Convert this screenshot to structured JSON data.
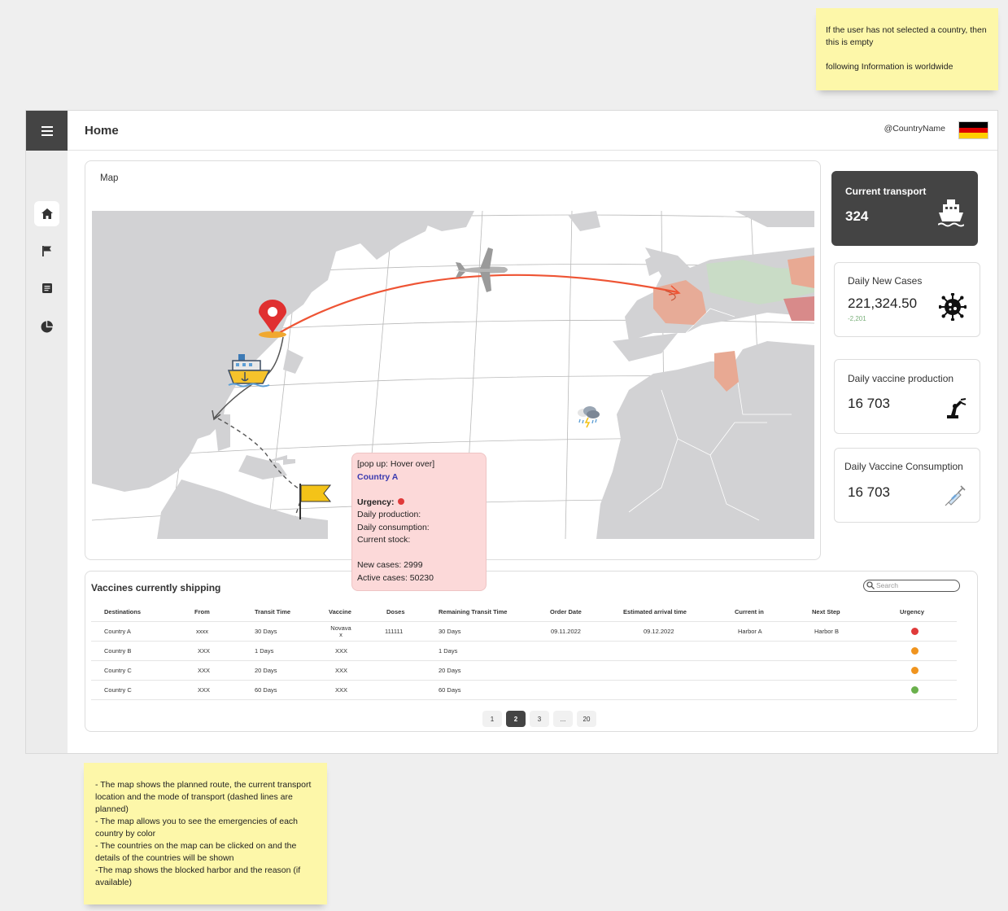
{
  "notes": {
    "top": [
      "If the user has not selected a country, then this is empty",
      "following Information is worldwide"
    ],
    "bottom": [
      "- The map shows the planned route, the current transport location and the mode of transport (dashed lines are planned)",
      "- The map allows you to see the emergencies of each country by color",
      "- The countries on the map can be clicked on and the details of the countries will be shown",
      "-The map shows the blocked harbor and the reason (if available)"
    ]
  },
  "header": {
    "title": "Home",
    "country": "@CountryName",
    "flag_colors": [
      "#000000",
      "#dd0000",
      "#ffce00"
    ]
  },
  "sidebar": {
    "items": [
      "home",
      "flag",
      "list",
      "pie-chart"
    ],
    "active": "home"
  },
  "map": {
    "title": "Map"
  },
  "popup": {
    "header": "[pop up: Hover over]",
    "country": "Country A",
    "urgency_label": "Urgency:",
    "urgency_color": "#e03a3a",
    "lines": [
      "Daily production:",
      "Daily consumption:",
      "Current stock:"
    ],
    "new_cases": "New cases: 2999",
    "active_cases": "Active cases:  50230"
  },
  "stats": {
    "transport": {
      "label": "Current transport",
      "value": "324"
    },
    "new_cases": {
      "label": "Daily New Cases",
      "value": "221,324.50",
      "delta": "-2,201"
    },
    "production": {
      "label": "Daily vaccine production",
      "value": "16 703"
    },
    "consumption": {
      "label": "Daily Vaccine Consumption",
      "value": "16 703"
    }
  },
  "table": {
    "title": "Vaccines currently shipping",
    "search_placeholder": "Search",
    "columns": [
      "Destinations",
      "From",
      "Transit Time",
      "Vaccine",
      "Doses",
      "Remaining Transit Time",
      "Order Date",
      "Estimated arrival time",
      "Current in",
      "Next Step",
      "Urgency"
    ],
    "rows": [
      [
        "Country A",
        "xxxx",
        "30 Days",
        "Novava x",
        "111111",
        "30 Days",
        "09.11.2022",
        "09.12.2022",
        "Harbor A",
        "Harbor B",
        "#e03a3a"
      ],
      [
        "Country B",
        "XXX",
        "1 Days",
        "XXX",
        "",
        "1 Days",
        "",
        "",
        "",
        "",
        "#f0941e"
      ],
      [
        "Country C",
        "XXX",
        "20 Days",
        "XXX",
        "",
        "20 Days",
        "",
        "",
        "",
        "",
        "#f0941e"
      ],
      [
        "Country C",
        "XXX",
        "60 Days",
        "XXX",
        "",
        "60 Days",
        "",
        "",
        "",
        "",
        "#6ab04c"
      ]
    ],
    "pages": [
      "1",
      "2",
      "3",
      "...",
      "20"
    ],
    "active_page": "2"
  }
}
